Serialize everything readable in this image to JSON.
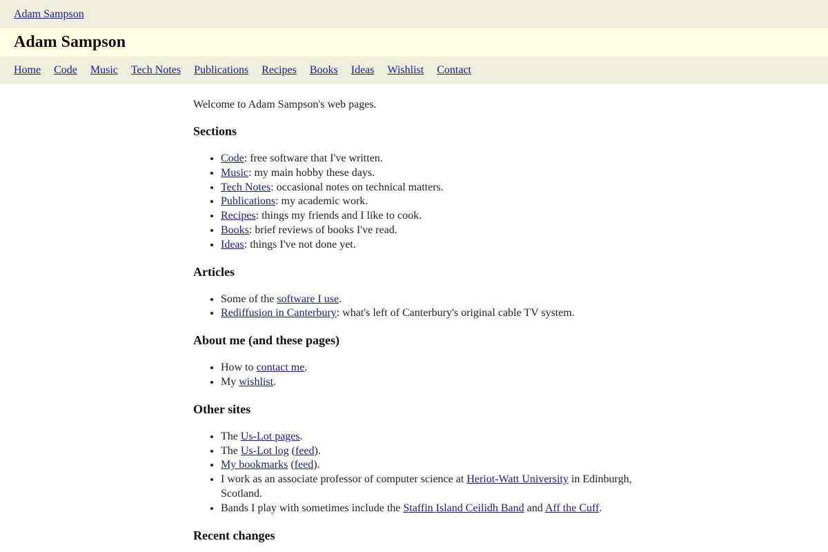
{
  "topbar": {
    "home_link": "Adam Sampson"
  },
  "header": {
    "title": "Adam Sampson"
  },
  "nav": {
    "items": [
      "Home",
      "Code",
      "Music",
      "Tech Notes",
      "Publications",
      "Recipes",
      "Books",
      "Ideas",
      "Wishlist",
      "Contact"
    ]
  },
  "intro": "Welcome to Adam Sampson's web pages.",
  "sections": {
    "heading": "Sections",
    "items": [
      {
        "link": "Code",
        "text": ": free software that I've written."
      },
      {
        "link": "Music",
        "text": ": my main hobby these days."
      },
      {
        "link": "Tech Notes",
        "text": ": occasional notes on technical matters."
      },
      {
        "link": "Publications",
        "text": ": my academic work."
      },
      {
        "link": "Recipes",
        "text": ": things my friends and I like to cook."
      },
      {
        "link": "Books",
        "text": ": brief reviews of books I've read."
      },
      {
        "link": "Ideas",
        "text": ": things I've not done yet."
      }
    ]
  },
  "articles": {
    "heading": "Articles",
    "item1": {
      "pre": "Some of the ",
      "link": "software I use",
      "post": "."
    },
    "item2": {
      "link": "Rediffusion in Canterbury",
      "post": ": what's left of Canterbury's original cable TV system."
    }
  },
  "about": {
    "heading": "About me (and these pages)",
    "item1": {
      "pre": "How to ",
      "link": "contact me",
      "post": "."
    },
    "item2": {
      "pre": "My ",
      "link": "wishlist",
      "post": "."
    }
  },
  "other": {
    "heading": "Other sites",
    "item1": {
      "pre": "The ",
      "link": "Us-Lot pages",
      "post": "."
    },
    "item2": {
      "pre": "The ",
      "link": "Us-Lot log",
      "mid": " (",
      "link2": "feed",
      "post": ")."
    },
    "item3": {
      "link": "My bookmarks",
      "mid": " (",
      "link2": "feed",
      "post": ")."
    },
    "item4": {
      "pre": "I work as an associate professor of computer science at ",
      "link": "Heriot-Watt University",
      "post": " in Edinburgh, Scotland."
    },
    "item5": {
      "pre": "Bands I play with sometimes include the ",
      "link": "Staffin Island Ceilidh Band",
      "mid": " and ",
      "link2": "Aff the Cuff",
      "post": "."
    }
  },
  "recent": {
    "heading": "Recent changes"
  }
}
